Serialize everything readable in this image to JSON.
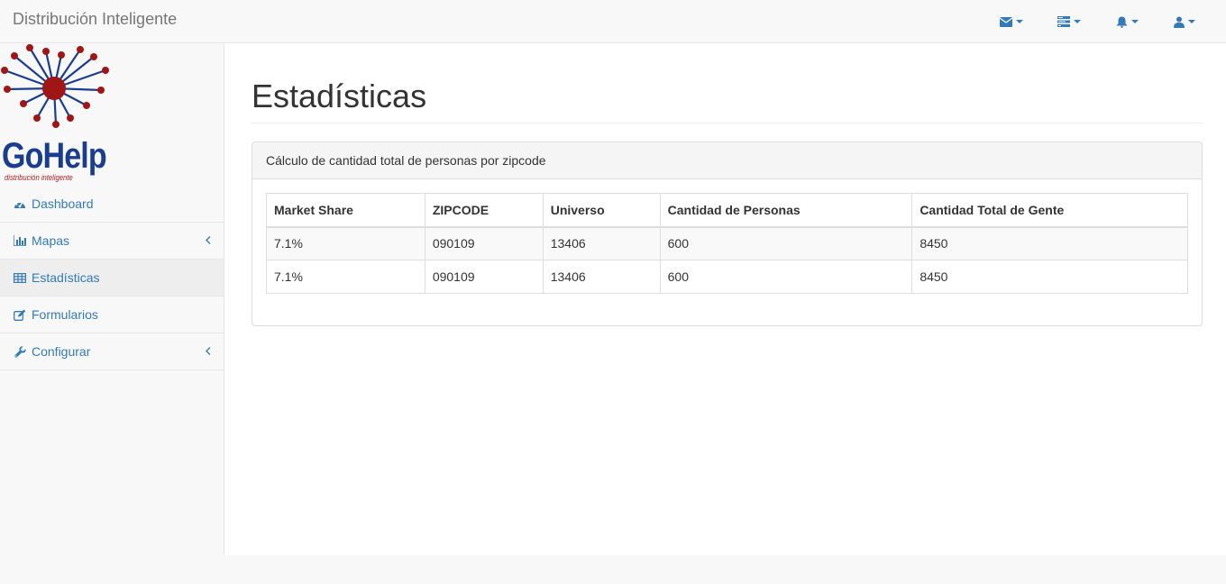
{
  "app": {
    "title": "Distribución Inteligente"
  },
  "logo": {
    "name": "GoHelp",
    "tagline": "distribución inteligente"
  },
  "topnav": [
    {
      "icon": "envelope-icon"
    },
    {
      "icon": "tasks-icon"
    },
    {
      "icon": "bell-icon"
    },
    {
      "icon": "user-icon"
    }
  ],
  "sidebar": {
    "items": [
      {
        "label": "Dashboard",
        "icon": "dashboard-icon",
        "expandable": false
      },
      {
        "label": "Mapas",
        "icon": "bar-chart-icon",
        "expandable": true
      },
      {
        "label": "Estadísticas",
        "icon": "table-icon",
        "expandable": false,
        "active": true
      },
      {
        "label": "Formularios",
        "icon": "edit-icon",
        "expandable": false
      },
      {
        "label": "Configurar",
        "icon": "wrench-icon",
        "expandable": true
      }
    ]
  },
  "main": {
    "page_title": "Estadísticas",
    "panel_title": "Cálculo de cantidad total de personas por zipcode",
    "table": {
      "headers": [
        "Market Share",
        "ZIPCODE",
        "Universo",
        "Cantidad de Personas",
        "Cantidad Total de Gente"
      ],
      "rows": [
        [
          "7.1%",
          "090109",
          "13406",
          "600",
          "8450"
        ],
        [
          "7.1%",
          "090109",
          "13406",
          "600",
          "8450"
        ]
      ]
    }
  },
  "colors": {
    "link": "#337ab7",
    "logo_blue": "#1a3d8f",
    "logo_red": "#b22222"
  }
}
